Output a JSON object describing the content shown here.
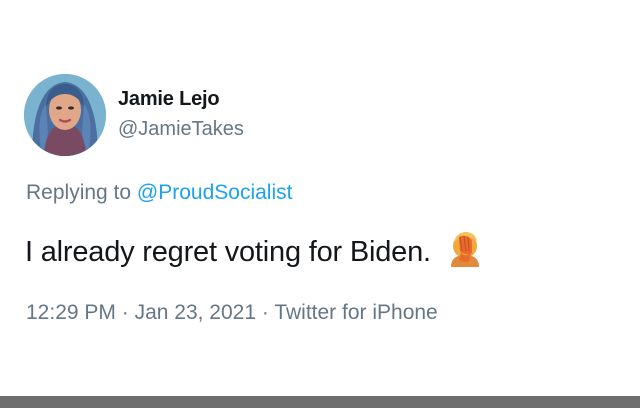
{
  "tweet": {
    "author": {
      "display_name": "Jamie Lejo",
      "handle": "@JamieTakes"
    },
    "reply": {
      "prefix": "Replying to",
      "mention": "@ProudSocialist"
    },
    "text": "I already regret voting for Biden.",
    "emoji": "face-palm-icon",
    "meta": {
      "time": "12:29 PM",
      "date": "Jan 23, 2021",
      "source": "Twitter for iPhone",
      "separator": "·"
    }
  },
  "colors": {
    "text_primary": "#14171a",
    "text_secondary": "#657786",
    "accent_blue": "#1da1f2",
    "background": "#ffffff"
  }
}
